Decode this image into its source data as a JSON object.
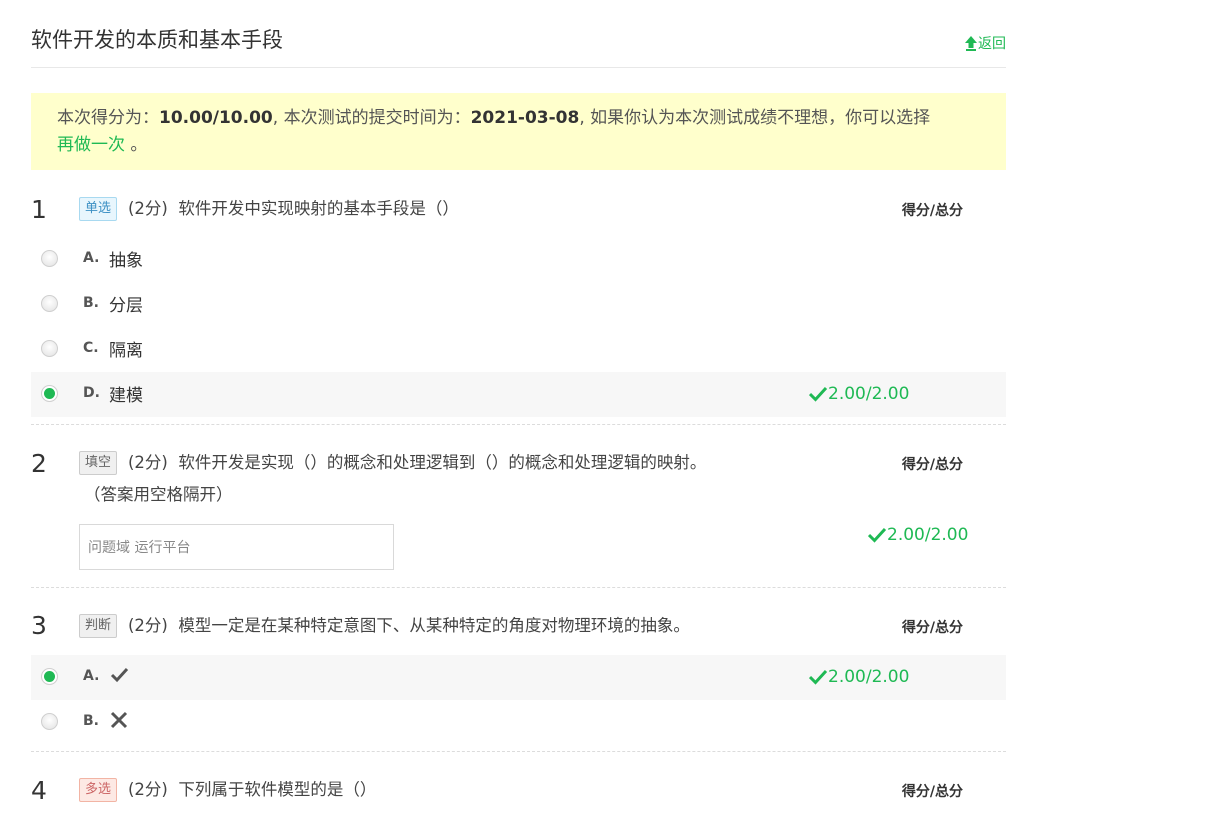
{
  "header": {
    "title": "软件开发的本质和基本手段",
    "back_label": "返回"
  },
  "notice": {
    "prefix": "本次得分为：",
    "score": "10.00/10.00",
    "mid": ", 本次测试的提交时间为：",
    "date": "2021-03-08",
    "suffix": ", 如果你认为本次测试成绩不理想，你可以选择",
    "redo_label": "再做一次",
    "end": " 。"
  },
  "score_header": "得分/总分",
  "questions": [
    {
      "number": "1",
      "type": "单选",
      "points": "(2分)",
      "text": "软件开发中实现映射的基本手段是（）",
      "options": [
        {
          "letter": "A.",
          "text": "抽象",
          "selected": false
        },
        {
          "letter": "B.",
          "text": "分层",
          "selected": false
        },
        {
          "letter": "C.",
          "text": "隔离",
          "selected": false
        },
        {
          "letter": "D.",
          "text": "建模",
          "selected": true
        }
      ],
      "score": "2.00/2.00"
    },
    {
      "number": "2",
      "type": "填空",
      "points": "(2分)",
      "text": "软件开发是实现（）的概念和处理逻辑到（）的概念和处理逻辑的映射。",
      "text2": "（答案用空格隔开）",
      "answer": "问题域 运行平台",
      "score": " 2.00/2.00"
    },
    {
      "number": "3",
      "type": "判断",
      "points": "(2分)",
      "text": "模型一定是在某种特定意图下、从某种特定的角度对物理环境的抽象。",
      "options": [
        {
          "letter": "A.",
          "icon": "check-icon",
          "selected": true
        },
        {
          "letter": "B.",
          "icon": "cross-icon",
          "selected": false
        }
      ],
      "score": "2.00/2.00"
    },
    {
      "number": "4",
      "type": "多选",
      "points": "(2分)",
      "text": "下列属于软件模型的是（）"
    }
  ],
  "colors": {
    "accent": "#1fb954",
    "notice_bg": "#ffffcc"
  }
}
